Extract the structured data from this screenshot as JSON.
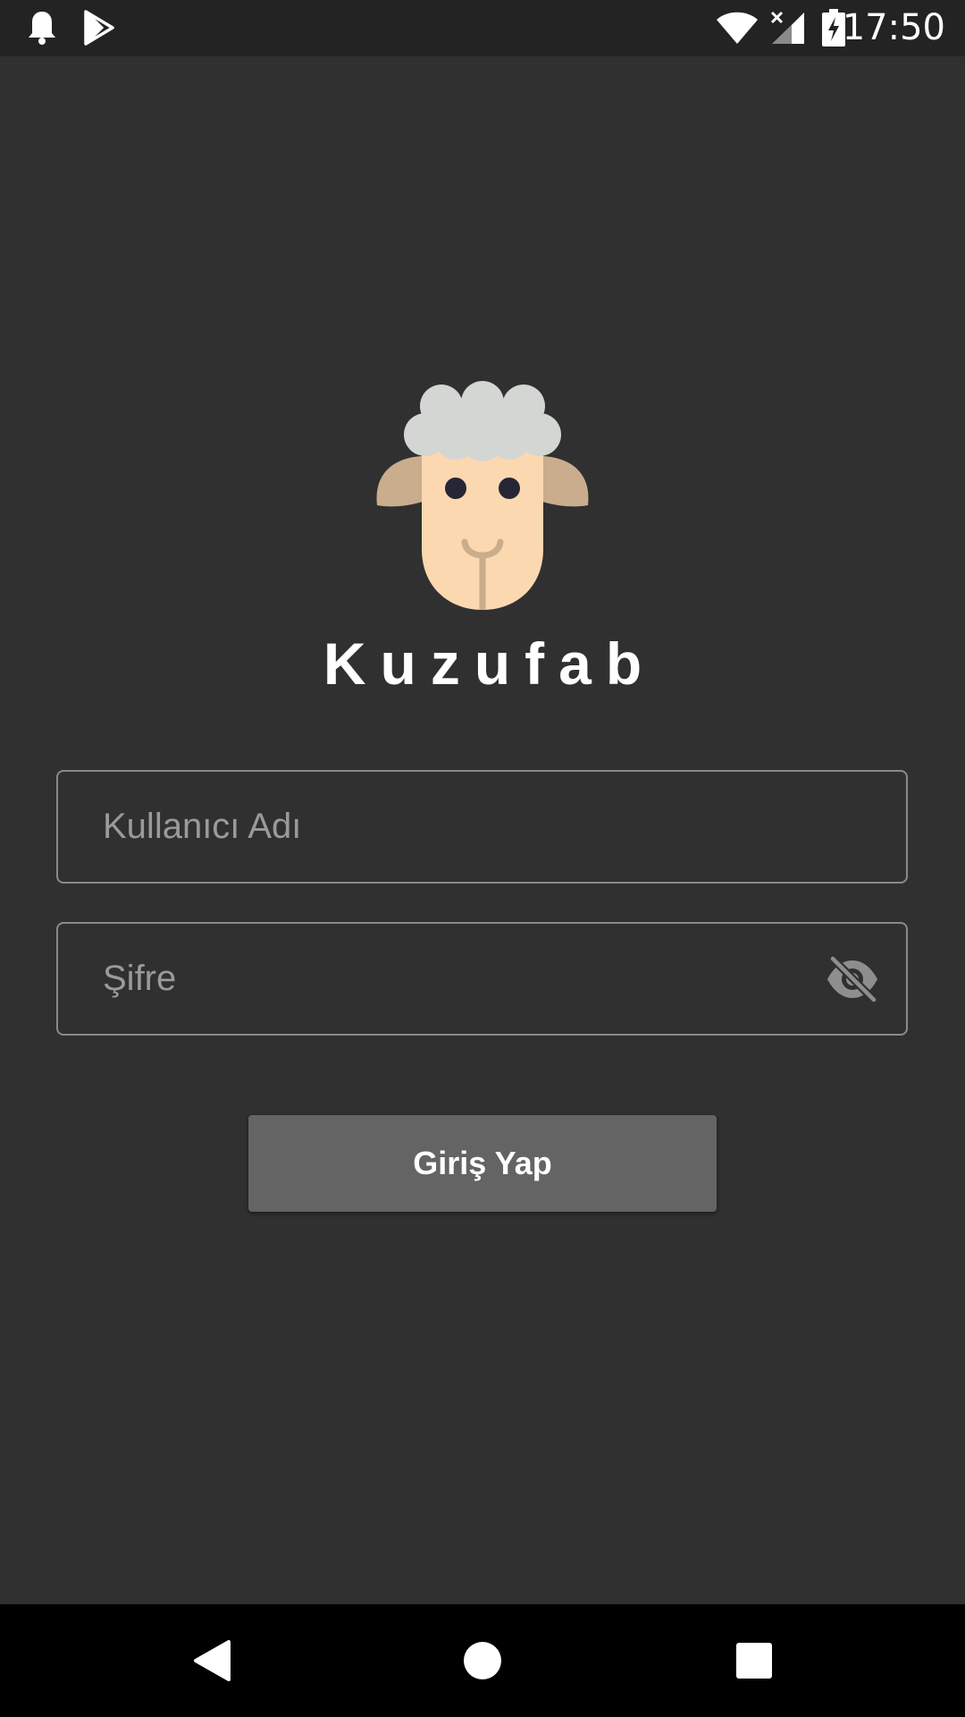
{
  "status_bar": {
    "time": "17:50",
    "left_icons": [
      "notification-bell-icon",
      "play-store-icon"
    ],
    "right_icons": [
      "wifi-icon",
      "cellular-signal-no-service-icon",
      "battery-charging-icon"
    ]
  },
  "app": {
    "name": "Kuzufab",
    "logo": "sheep-logo"
  },
  "login_form": {
    "username": {
      "placeholder": "Kullanıcı Adı",
      "value": ""
    },
    "password": {
      "placeholder": "Şifre",
      "value": "",
      "toggle_icon": "visibility-off-icon"
    },
    "submit_label": "Giriş Yap"
  },
  "nav_bar": {
    "buttons": [
      "back-icon",
      "home-icon",
      "recents-icon"
    ]
  },
  "colors": {
    "background": "#303030",
    "status_bar": "#232323",
    "button": "#646464",
    "field_border": "#8a8a8a",
    "placeholder": "#9a9a9a",
    "sheep_wool": "#d4d6d4",
    "sheep_face": "#fcd8b0",
    "sheep_ear": "#c9ad8d"
  }
}
